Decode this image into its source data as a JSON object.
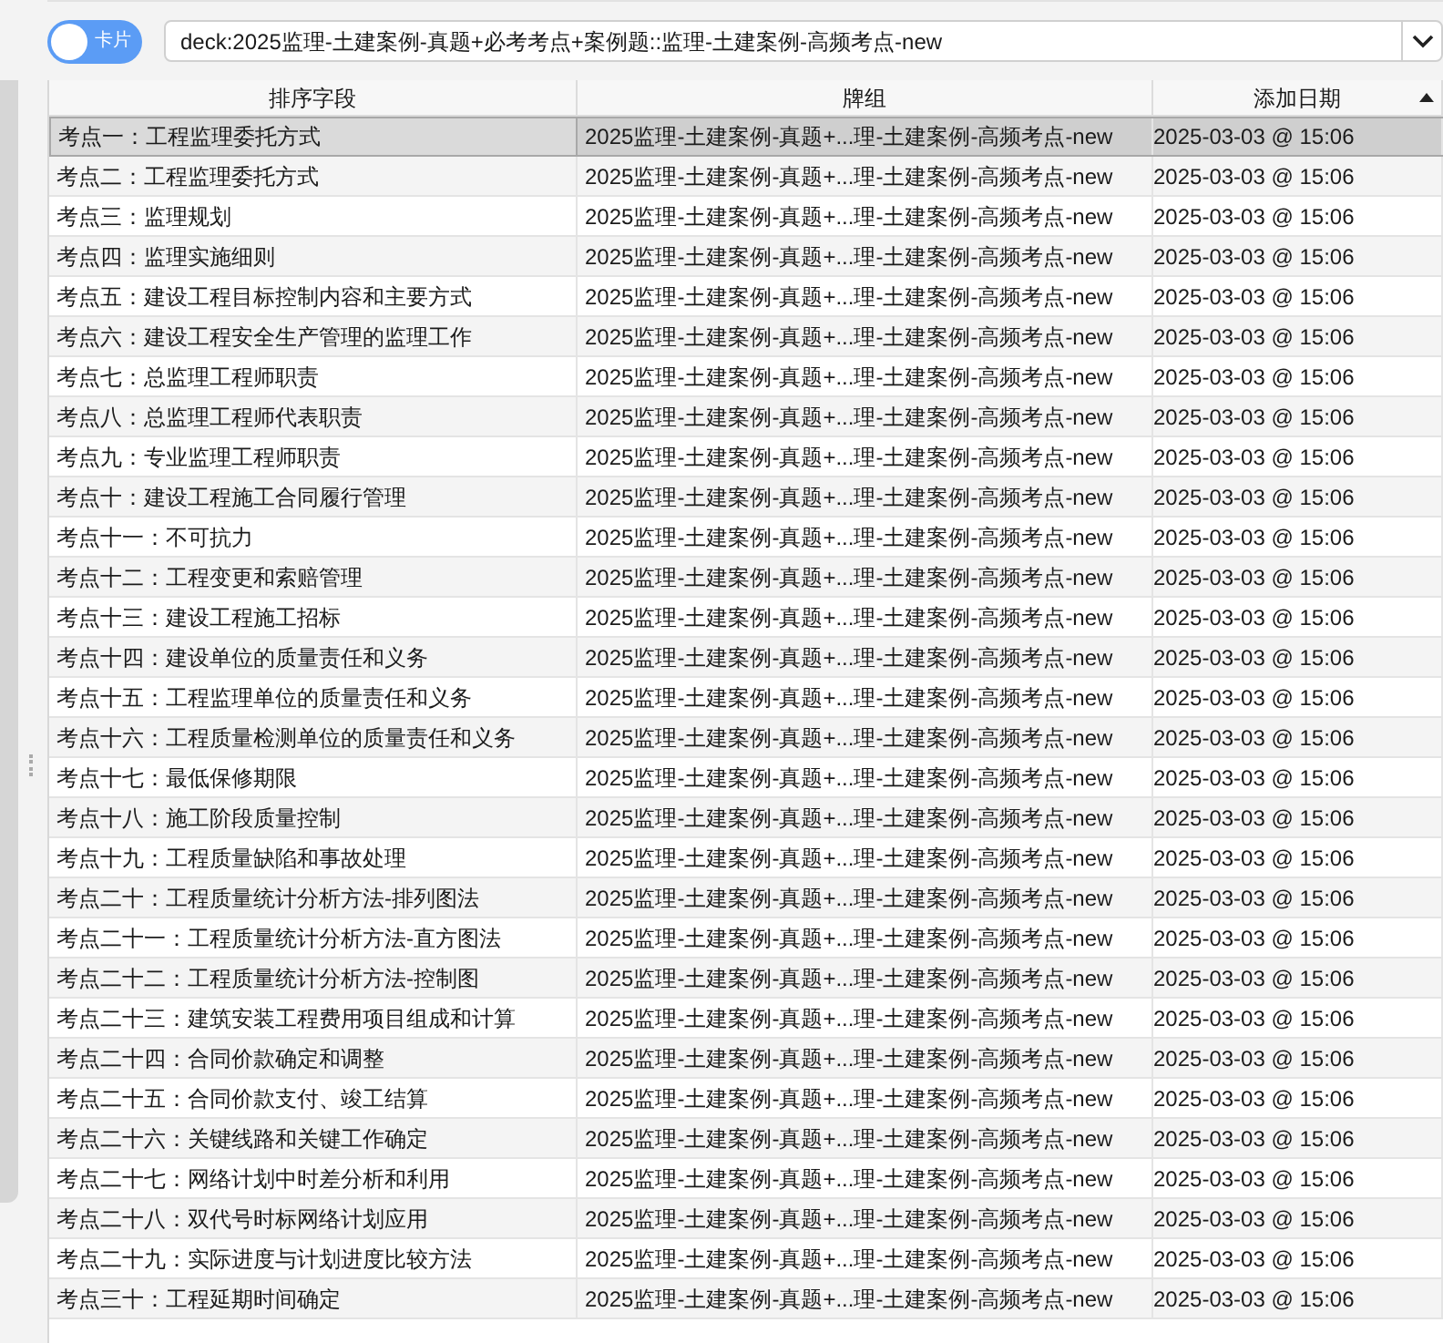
{
  "toggle": {
    "label": "卡片"
  },
  "search": {
    "value": "deck:2025监理-土建案例-真题+必考考点+案例题::监理-土建案例-高频考点-new"
  },
  "table": {
    "columns": [
      {
        "label": "排序字段",
        "sorted": false
      },
      {
        "label": "牌组",
        "sorted": false
      },
      {
        "label": "添加日期",
        "sorted": true
      }
    ],
    "rows": [
      {
        "cells": [
          "考点一：工程监理委托方式",
          "2025监理-土建案例-真题+...理-土建案例-高频考点-new",
          "2025-03-03 @ 15:06"
        ],
        "selected": true
      },
      {
        "cells": [
          "考点二：工程监理委托方式",
          "2025监理-土建案例-真题+...理-土建案例-高频考点-new",
          "2025-03-03 @ 15:06"
        ],
        "selected": false
      },
      {
        "cells": [
          "考点三：监理规划",
          "2025监理-土建案例-真题+...理-土建案例-高频考点-new",
          "2025-03-03 @ 15:06"
        ],
        "selected": false
      },
      {
        "cells": [
          "考点四：监理实施细则",
          "2025监理-土建案例-真题+...理-土建案例-高频考点-new",
          "2025-03-03 @ 15:06"
        ],
        "selected": false
      },
      {
        "cells": [
          "考点五：建设工程目标控制内容和主要方式",
          "2025监理-土建案例-真题+...理-土建案例-高频考点-new",
          "2025-03-03 @ 15:06"
        ],
        "selected": false
      },
      {
        "cells": [
          "考点六：建设工程安全生产管理的监理工作",
          "2025监理-土建案例-真题+...理-土建案例-高频考点-new",
          "2025-03-03 @ 15:06"
        ],
        "selected": false
      },
      {
        "cells": [
          "考点七：总监理工程师职责",
          "2025监理-土建案例-真题+...理-土建案例-高频考点-new",
          "2025-03-03 @ 15:06"
        ],
        "selected": false
      },
      {
        "cells": [
          "考点八：总监理工程师代表职责",
          "2025监理-土建案例-真题+...理-土建案例-高频考点-new",
          "2025-03-03 @ 15:06"
        ],
        "selected": false
      },
      {
        "cells": [
          "考点九：专业监理工程师职责",
          "2025监理-土建案例-真题+...理-土建案例-高频考点-new",
          "2025-03-03 @ 15:06"
        ],
        "selected": false
      },
      {
        "cells": [
          "考点十：建设工程施工合同履行管理",
          "2025监理-土建案例-真题+...理-土建案例-高频考点-new",
          "2025-03-03 @ 15:06"
        ],
        "selected": false
      },
      {
        "cells": [
          "考点十一：不可抗力",
          "2025监理-土建案例-真题+...理-土建案例-高频考点-new",
          "2025-03-03 @ 15:06"
        ],
        "selected": false
      },
      {
        "cells": [
          "考点十二：工程变更和索赔管理",
          "2025监理-土建案例-真题+...理-土建案例-高频考点-new",
          "2025-03-03 @ 15:06"
        ],
        "selected": false
      },
      {
        "cells": [
          "考点十三：建设工程施工招标",
          "2025监理-土建案例-真题+...理-土建案例-高频考点-new",
          "2025-03-03 @ 15:06"
        ],
        "selected": false
      },
      {
        "cells": [
          "考点十四：建设单位的质量责任和义务",
          "2025监理-土建案例-真题+...理-土建案例-高频考点-new",
          "2025-03-03 @ 15:06"
        ],
        "selected": false
      },
      {
        "cells": [
          "考点十五：工程监理单位的质量责任和义务",
          "2025监理-土建案例-真题+...理-土建案例-高频考点-new",
          "2025-03-03 @ 15:06"
        ],
        "selected": false
      },
      {
        "cells": [
          "考点十六：工程质量检测单位的质量责任和义务",
          "2025监理-土建案例-真题+...理-土建案例-高频考点-new",
          "2025-03-03 @ 15:06"
        ],
        "selected": false
      },
      {
        "cells": [
          "考点十七：最低保修期限",
          "2025监理-土建案例-真题+...理-土建案例-高频考点-new",
          "2025-03-03 @ 15:06"
        ],
        "selected": false
      },
      {
        "cells": [
          "考点十八：施工阶段质量控制",
          "2025监理-土建案例-真题+...理-土建案例-高频考点-new",
          "2025-03-03 @ 15:06"
        ],
        "selected": false
      },
      {
        "cells": [
          "考点十九：工程质量缺陷和事故处理",
          "2025监理-土建案例-真题+...理-土建案例-高频考点-new",
          "2025-03-03 @ 15:06"
        ],
        "selected": false
      },
      {
        "cells": [
          "考点二十：工程质量统计分析方法-排列图法",
          "2025监理-土建案例-真题+...理-土建案例-高频考点-new",
          "2025-03-03 @ 15:06"
        ],
        "selected": false
      },
      {
        "cells": [
          "考点二十一：工程质量统计分析方法-直方图法",
          "2025监理-土建案例-真题+...理-土建案例-高频考点-new",
          "2025-03-03 @ 15:06"
        ],
        "selected": false
      },
      {
        "cells": [
          "考点二十二：工程质量统计分析方法-控制图",
          "2025监理-土建案例-真题+...理-土建案例-高频考点-new",
          "2025-03-03 @ 15:06"
        ],
        "selected": false
      },
      {
        "cells": [
          "考点二十三：建筑安装工程费用项目组成和计算",
          "2025监理-土建案例-真题+...理-土建案例-高频考点-new",
          "2025-03-03 @ 15:06"
        ],
        "selected": false
      },
      {
        "cells": [
          "考点二十四：合同价款确定和调整",
          "2025监理-土建案例-真题+...理-土建案例-高频考点-new",
          "2025-03-03 @ 15:06"
        ],
        "selected": false
      },
      {
        "cells": [
          "考点二十五：合同价款支付、竣工结算",
          "2025监理-土建案例-真题+...理-土建案例-高频考点-new",
          "2025-03-03 @ 15:06"
        ],
        "selected": false
      },
      {
        "cells": [
          "考点二十六：关键线路和关键工作确定",
          "2025监理-土建案例-真题+...理-土建案例-高频考点-new",
          "2025-03-03 @ 15:06"
        ],
        "selected": false
      },
      {
        "cells": [
          "考点二十七：网络计划中时差分析和利用",
          "2025监理-土建案例-真题+...理-土建案例-高频考点-new",
          "2025-03-03 @ 15:06"
        ],
        "selected": false
      },
      {
        "cells": [
          "考点二十八：双代号时标网络计划应用",
          "2025监理-土建案例-真题+...理-土建案例-高频考点-new",
          "2025-03-03 @ 15:06"
        ],
        "selected": false
      },
      {
        "cells": [
          "考点二十九：实际进度与计划进度比较方法",
          "2025监理-土建案例-真题+...理-土建案例-高频考点-new",
          "2025-03-03 @ 15:06"
        ],
        "selected": false
      },
      {
        "cells": [
          "考点三十：工程延期时间确定",
          "2025监理-土建案例-真题+...理-土建案例-高频考点-new",
          "2025-03-03 @ 15:06"
        ],
        "selected": false
      }
    ]
  }
}
